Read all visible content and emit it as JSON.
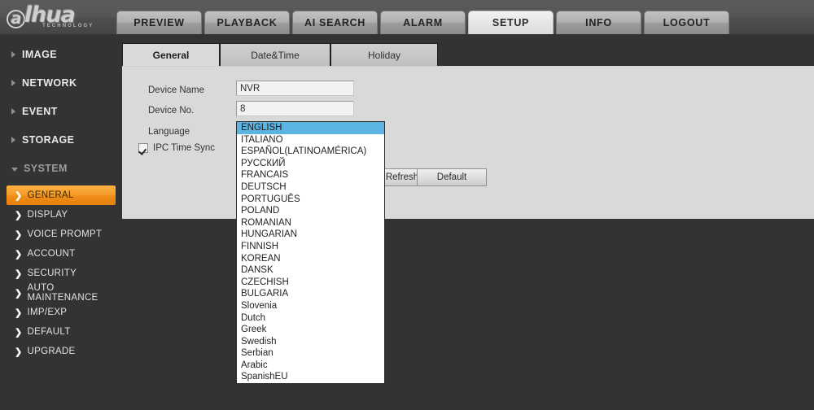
{
  "brand": {
    "logo_at": "a",
    "logo_text": "lhua",
    "logo_sub": "TECHNOLOGY"
  },
  "mainnav": {
    "tabs": [
      {
        "label": "PREVIEW",
        "active": false
      },
      {
        "label": "PLAYBACK",
        "active": false
      },
      {
        "label": "AI SEARCH",
        "active": false
      },
      {
        "label": "ALARM",
        "active": false
      },
      {
        "label": "SETUP",
        "active": true
      },
      {
        "label": "INFO",
        "active": false
      },
      {
        "label": "LOGOUT",
        "active": false
      }
    ]
  },
  "sidebar": {
    "groups": [
      {
        "label": "IMAGE",
        "expanded": false
      },
      {
        "label": "NETWORK",
        "expanded": false
      },
      {
        "label": "EVENT",
        "expanded": false
      },
      {
        "label": "STORAGE",
        "expanded": false
      },
      {
        "label": "SYSTEM",
        "expanded": true
      }
    ],
    "sub_items": [
      {
        "label": "GENERAL",
        "active": true
      },
      {
        "label": "DISPLAY",
        "active": false
      },
      {
        "label": "VOICE PROMPT",
        "active": false
      },
      {
        "label": "ACCOUNT",
        "active": false
      },
      {
        "label": "SECURITY",
        "active": false
      },
      {
        "label": "AUTO MAINTENANCE",
        "active": false
      },
      {
        "label": "IMP/EXP",
        "active": false
      },
      {
        "label": "DEFAULT",
        "active": false
      },
      {
        "label": "UPGRADE",
        "active": false
      }
    ]
  },
  "content": {
    "tabs": [
      {
        "label": "General",
        "active": true
      },
      {
        "label": "Date&Time",
        "active": false
      },
      {
        "label": "Holiday",
        "active": false
      }
    ],
    "form": {
      "device_name_label": "Device Name",
      "device_name_value": "NVR",
      "device_no_label": "Device No.",
      "device_no_value": "8",
      "language_label": "Language",
      "language_value": "ENGLISH",
      "ipc_time_sync_label": "IPC Time Sync",
      "ipc_time_sync_checked": true
    },
    "buttons": {
      "refresh_label": "Refresh",
      "default_label": "Default"
    }
  },
  "language_options": [
    {
      "label": "ENGLISH",
      "selected": true
    },
    {
      "label": "ITALIANO",
      "selected": false
    },
    {
      "label": "ESPAÑOL(LATINOAMÉRICA)",
      "selected": false
    },
    {
      "label": "РУССКИЙ",
      "selected": false
    },
    {
      "label": "FRANCAIS",
      "selected": false
    },
    {
      "label": "DEUTSCH",
      "selected": false
    },
    {
      "label": "PORTUGUÊS",
      "selected": false
    },
    {
      "label": "POLAND",
      "selected": false
    },
    {
      "label": "ROMANIAN",
      "selected": false
    },
    {
      "label": "HUNGARIAN",
      "selected": false
    },
    {
      "label": "FINNISH",
      "selected": false
    },
    {
      "label": "KOREAN",
      "selected": false
    },
    {
      "label": "DANSK",
      "selected": false
    },
    {
      "label": "CZECHISH",
      "selected": false
    },
    {
      "label": "BULGARIA",
      "selected": false
    },
    {
      "label": "Slovenia",
      "selected": false
    },
    {
      "label": "Dutch",
      "selected": false
    },
    {
      "label": "Greek",
      "selected": false
    },
    {
      "label": "Swedish",
      "selected": false
    },
    {
      "label": "Serbian",
      "selected": false
    },
    {
      "label": "Arabic",
      "selected": false
    },
    {
      "label": "SpanishEU",
      "selected": false
    }
  ],
  "colors": {
    "page_bg": "#333333",
    "panel_bg": "#d9d9d9",
    "accent_orange": "#f59d2c",
    "select_blue": "#5cb4e2"
  }
}
